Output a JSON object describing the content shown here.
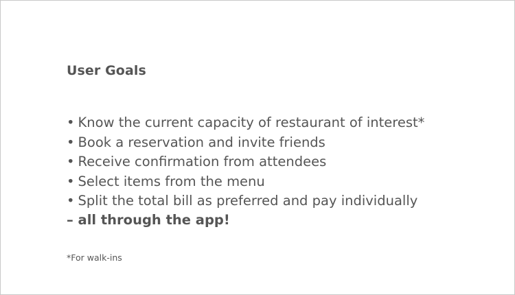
{
  "slide": {
    "title": "User Goals",
    "bullet_glyph": "•",
    "goals": [
      "Know the current capacity of restaurant of interest*",
      "Book a reservation and invite friends",
      "Receive confirmation from attendees",
      "Select items from the menu",
      "Split the total bill as preferred and pay individually"
    ],
    "tagline": "– all through the app!",
    "footnote": "*For walk-ins"
  },
  "colors": {
    "text": "#555555",
    "background": "#ffffff",
    "border": "#c8c8c8"
  }
}
